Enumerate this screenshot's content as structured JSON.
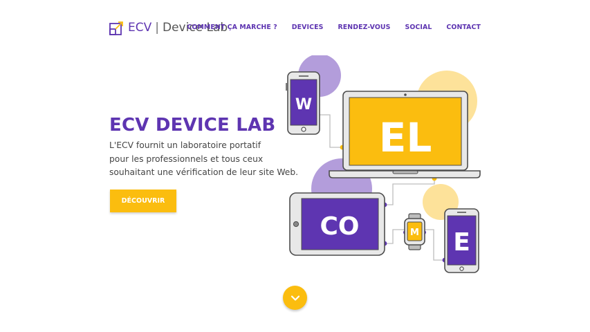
{
  "header": {
    "logo": {
      "ecv": "ECV",
      "separator": "|",
      "lab": "Device Lab",
      "icon": "logo-arrow-square-icon"
    },
    "nav": [
      {
        "label": "COMMENT ÇA MARCHE ?"
      },
      {
        "label": "DEVICES"
      },
      {
        "label": "RENDEZ-VOUS"
      },
      {
        "label": "SOCIAL"
      },
      {
        "label": "CONTACT"
      }
    ]
  },
  "hero": {
    "title": "ECV DEVICE LAB",
    "description_lines": [
      "L'ECV fournit un laboratoire portatif",
      "pour les professionnels et tous ceux",
      "souhaitant une vérification de leur site Web."
    ],
    "cta_label": "DÉCOUVRIR"
  },
  "illustration": {
    "phone_letter": "W",
    "laptop_letters": "EL",
    "tablet_letters": "CO",
    "watch_letter": "M",
    "phone2_letter": "E"
  },
  "scroll": {
    "icon": "chevron-down-icon"
  },
  "colors": {
    "purple": "#5e35b1",
    "yellow": "#fbbd0f",
    "light_purple": "#b39ddb",
    "light_yellow": "#fde29a",
    "device_gray": "#bdbdbd"
  }
}
